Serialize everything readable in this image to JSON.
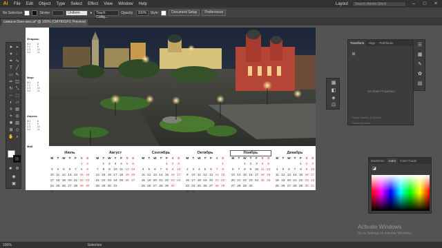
{
  "app": {
    "logo": "Ai",
    "menus": [
      "File",
      "Edit",
      "Object",
      "Type",
      "Select",
      "Effect",
      "View",
      "Window",
      "Help"
    ],
    "workspace": "Layout",
    "search_placeholder": "Search Adobe Stock",
    "window_buttons": [
      "–",
      "□",
      "×"
    ]
  },
  "control_bar": {
    "selection_label": "No Selection",
    "stroke_label": "Stroke:",
    "stroke_value": "",
    "uniform_label": "Uniform",
    "brush_label": "Touch Callig...",
    "opacity_label": "Opacity:",
    "opacity_value": "100%",
    "style_label": "Style:",
    "doc_setup": "Document Setup",
    "preferences": "Preferences"
  },
  "document_tab": {
    "title": "слика-в-2xee-wes.ai* @ 100% (CMYK/GPU Preview)"
  },
  "calendar": {
    "weekday_headers": [
      "M",
      "T",
      "W",
      "T",
      "F",
      "S",
      "S"
    ],
    "months": [
      {
        "name": "Июль",
        "rows": [
          [
            "",
            "",
            "",
            "",
            "",
            "1",
            "2"
          ],
          [
            "3",
            "4",
            "5",
            "6",
            "7",
            "8",
            "9"
          ],
          [
            "10",
            "11",
            "12",
            "13",
            "14",
            "15",
            "16"
          ],
          [
            "17",
            "18",
            "19",
            "20",
            "21",
            "22",
            "23"
          ],
          [
            "24",
            "25",
            "26",
            "27",
            "28",
            "29",
            "30"
          ],
          [
            "31",
            "",
            "",
            "",
            "",
            "",
            ""
          ]
        ]
      },
      {
        "name": "Август",
        "rows": [
          [
            "",
            "1",
            "2",
            "3",
            "4",
            "5",
            "6"
          ],
          [
            "7",
            "8",
            "9",
            "10",
            "11",
            "12",
            "13"
          ],
          [
            "14",
            "15",
            "16",
            "17",
            "18",
            "19",
            "20"
          ],
          [
            "21",
            "22",
            "23",
            "24",
            "25",
            "26",
            "27"
          ],
          [
            "28",
            "29",
            "30",
            "31",
            "",
            "",
            ""
          ],
          [
            "",
            "",
            "",
            "",
            "",
            "",
            ""
          ]
        ]
      },
      {
        "name": "Сентябрь",
        "rows": [
          [
            "",
            "",
            "",
            "",
            "1",
            "2",
            "3"
          ],
          [
            "4",
            "5",
            "6",
            "7",
            "8",
            "9",
            "10"
          ],
          [
            "11",
            "12",
            "13",
            "14",
            "15",
            "16",
            "17"
          ],
          [
            "18",
            "19",
            "20",
            "21",
            "22",
            "23",
            "24"
          ],
          [
            "25",
            "26",
            "27",
            "28",
            "29",
            "30",
            ""
          ],
          [
            "",
            "",
            "",
            "",
            "",
            "",
            ""
          ]
        ]
      },
      {
        "name": "Октябрь",
        "rows": [
          [
            "",
            "",
            "",
            "",
            "",
            "",
            "1"
          ],
          [
            "2",
            "3",
            "4",
            "5",
            "6",
            "7",
            "8"
          ],
          [
            "9",
            "10",
            "11",
            "12",
            "13",
            "14",
            "15"
          ],
          [
            "16",
            "17",
            "18",
            "19",
            "20",
            "21",
            "22"
          ],
          [
            "23",
            "24",
            "25",
            "26",
            "27",
            "28",
            "29"
          ],
          [
            "30",
            "31",
            "",
            "",
            "",
            "",
            ""
          ]
        ]
      },
      {
        "name": "Ноябрь",
        "rows": [
          [
            "",
            "",
            "1",
            "2",
            "3",
            "4",
            "5"
          ],
          [
            "6",
            "7",
            "8",
            "9",
            "10",
            "11",
            "12"
          ],
          [
            "13",
            "14",
            "15",
            "16",
            "17",
            "18",
            "19"
          ],
          [
            "20",
            "21",
            "22",
            "23",
            "24",
            "25",
            "26"
          ],
          [
            "27",
            "28",
            "29",
            "30",
            "",
            "",
            ""
          ],
          [
            "",
            "",
            "",
            "",
            "",
            "",
            ""
          ]
        ]
      },
      {
        "name": "Декабрь",
        "rows": [
          [
            "",
            "",
            "",
            "",
            "1",
            "2",
            "3"
          ],
          [
            "4",
            "5",
            "6",
            "7",
            "8",
            "9",
            "10"
          ],
          [
            "11",
            "12",
            "13",
            "14",
            "15",
            "16",
            "17"
          ],
          [
            "18",
            "19",
            "20",
            "21",
            "22",
            "23",
            "24"
          ],
          [
            "25",
            "26",
            "27",
            "28",
            "29",
            "30",
            "31"
          ],
          [
            "",
            "",
            "",
            "",
            "",
            "",
            ""
          ]
        ]
      }
    ]
  },
  "side_months": [
    "Февраль",
    "Март",
    "Апрель",
    "Май"
  ],
  "panels": {
    "transform_tabs": [
      "Transform",
      "Align",
      "Pathfinder"
    ],
    "transform_empty": "No State Properties",
    "scale_strokes": "Scale Strokes & Effects",
    "scale_corners": "Scale Corners",
    "color_tabs": [
      "Swatches",
      "Color",
      "Color Guide"
    ]
  },
  "watermark": {
    "line1": "Activate Windows",
    "line2": "Go to Settings to activate Windows."
  },
  "status": {
    "zoom": "100%",
    "tool": "Selection"
  },
  "colors": {
    "accent_logo": "#ff9a00",
    "weekend_red": "#d83a3a",
    "ui_dark": "#323232",
    "canvas_gray": "#535353"
  }
}
